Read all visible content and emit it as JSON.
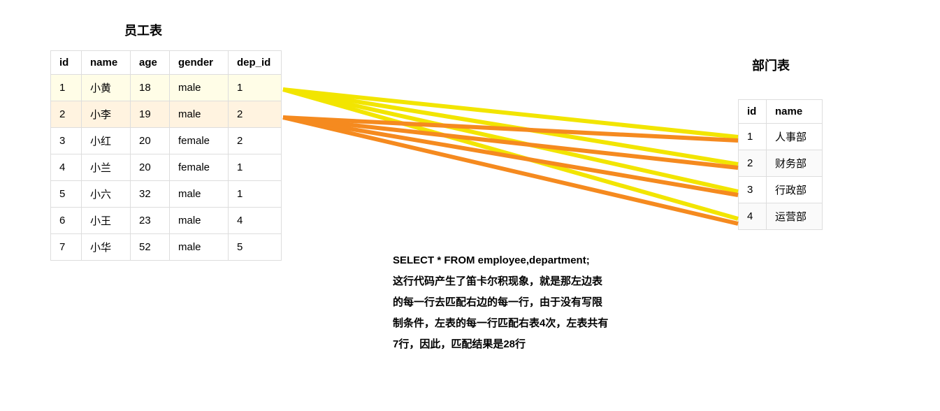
{
  "employee": {
    "title": "员工表",
    "headers": [
      "id",
      "name",
      "age",
      "gender",
      "dep_id"
    ],
    "rows": [
      {
        "id": "1",
        "name": "小黄",
        "age": "18",
        "gender": "male",
        "dep_id": "1"
      },
      {
        "id": "2",
        "name": "小李",
        "age": "19",
        "gender": "male",
        "dep_id": "2"
      },
      {
        "id": "3",
        "name": "小红",
        "age": "20",
        "gender": "female",
        "dep_id": "2"
      },
      {
        "id": "4",
        "name": "小兰",
        "age": "20",
        "gender": "female",
        "dep_id": "1"
      },
      {
        "id": "5",
        "name": "小六",
        "age": "32",
        "gender": "male",
        "dep_id": "1"
      },
      {
        "id": "6",
        "name": "小王",
        "age": "23",
        "gender": "male",
        "dep_id": "4"
      },
      {
        "id": "7",
        "name": "小华",
        "age": "52",
        "gender": "male",
        "dep_id": "5"
      }
    ]
  },
  "department": {
    "title": "部门表",
    "headers": [
      "id",
      "name"
    ],
    "rows": [
      {
        "id": "1",
        "name": "人事部"
      },
      {
        "id": "2",
        "name": "财务部"
      },
      {
        "id": "3",
        "name": "行政部"
      },
      {
        "id": "4",
        "name": "运营部"
      }
    ]
  },
  "explain": {
    "line1": "SELECT * FROM employee,department;",
    "line2": "这行代码产生了笛卡尔积现象，就是那左边表",
    "line3": "的每一行去匹配右边的每一行，由于没有写限",
    "line4": "制条件，左表的每一行匹配右表4次，左表共有",
    "line5": "7行，因此，匹配结果是28行"
  },
  "colors": {
    "yellow": "#f2e500",
    "orange": "#f58a1f"
  }
}
